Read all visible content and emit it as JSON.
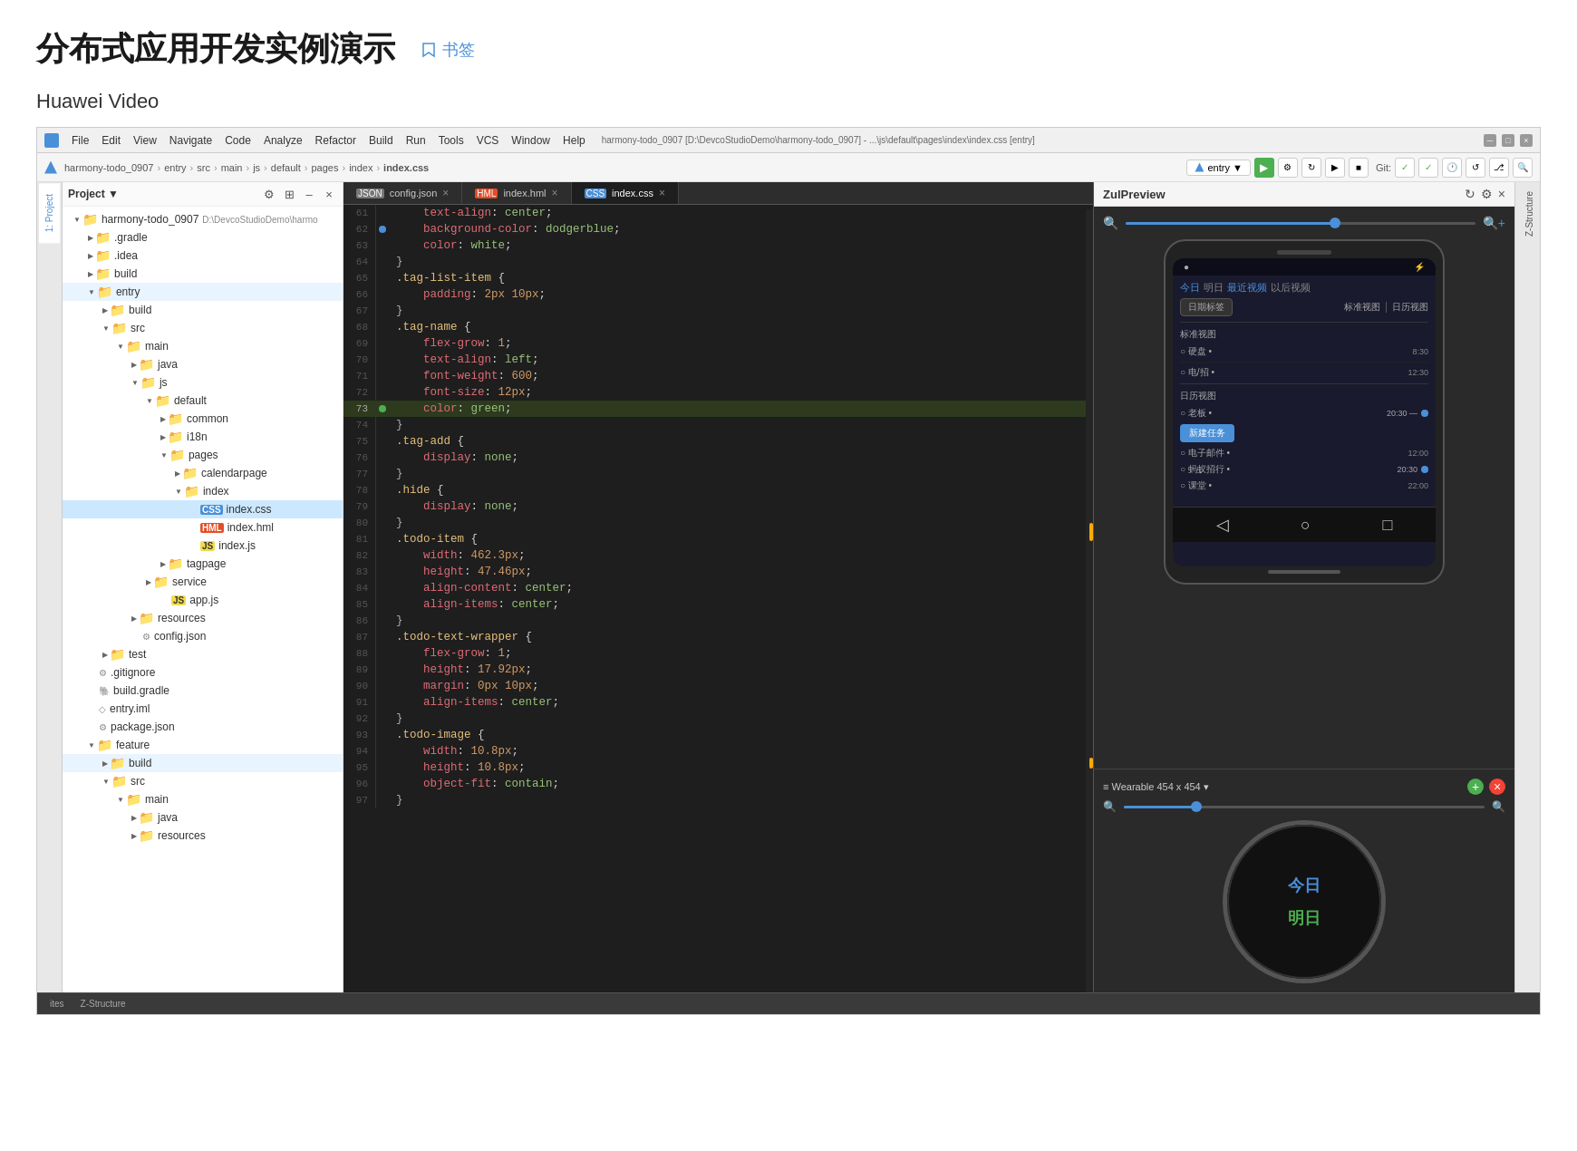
{
  "page": {
    "title": "分布式应用开发实例演示",
    "bookmark_label": "书签",
    "section_title": "Huawei Video"
  },
  "ide": {
    "menubar": {
      "items": [
        "File",
        "Edit",
        "View",
        "Navigate",
        "Code",
        "Analyze",
        "Refactor",
        "Build",
        "Run",
        "Tools",
        "VCS",
        "Window",
        "Help"
      ],
      "window_title": "harmony-todo_0907 [D:\\DevcoStudioDemo\\harmony-todo_0907] - ...\\js\\default\\pages\\index\\index.css [entry]"
    },
    "toolbar": {
      "breadcrumb": [
        "harmony-todo_0907",
        "entry",
        "src",
        "main",
        "js",
        "default",
        "pages",
        "index",
        "index.css"
      ],
      "entry_dropdown": "entry ▼",
      "run_label": "▶"
    },
    "tabs": [
      {
        "name": "config.json",
        "icon": "json",
        "active": false
      },
      {
        "name": "index.hml",
        "icon": "html",
        "active": false
      },
      {
        "name": "index.css",
        "icon": "css",
        "active": true
      }
    ],
    "preview_title": "ZulPreview",
    "side_tabs": [
      "1: Project"
    ],
    "bottom_tabs": [
      "Z-Structure",
      "ites"
    ]
  },
  "file_tree": {
    "root": "Project ▼",
    "items": [
      {
        "id": "harmony-root",
        "label": "harmony-todo_0907",
        "path": "D:\\DevcoStudioDemo\\harmo",
        "type": "folder",
        "depth": 0,
        "open": true
      },
      {
        "id": "gradle",
        "label": ".gradle",
        "type": "folder",
        "depth": 1,
        "open": false
      },
      {
        "id": "idea",
        "label": ".idea",
        "type": "folder",
        "depth": 1,
        "open": false
      },
      {
        "id": "build",
        "label": "build",
        "type": "folder",
        "depth": 1,
        "open": false
      },
      {
        "id": "entry",
        "label": "entry",
        "type": "folder",
        "depth": 1,
        "open": true,
        "selected": false
      },
      {
        "id": "entry-build",
        "label": "build",
        "type": "folder",
        "depth": 2,
        "open": false
      },
      {
        "id": "entry-src",
        "label": "src",
        "type": "folder",
        "depth": 2,
        "open": true
      },
      {
        "id": "main",
        "label": "main",
        "type": "folder",
        "depth": 3,
        "open": true
      },
      {
        "id": "java",
        "label": "java",
        "type": "folder",
        "depth": 4,
        "open": false
      },
      {
        "id": "js",
        "label": "js",
        "type": "folder",
        "depth": 4,
        "open": true
      },
      {
        "id": "default",
        "label": "default",
        "type": "folder",
        "depth": 5,
        "open": true
      },
      {
        "id": "common",
        "label": "common",
        "type": "folder",
        "depth": 6,
        "open": false
      },
      {
        "id": "i18n",
        "label": "i18n",
        "type": "folder",
        "depth": 6,
        "open": false
      },
      {
        "id": "pages",
        "label": "pages",
        "type": "folder",
        "depth": 6,
        "open": true
      },
      {
        "id": "calendarpage",
        "label": "calendarpage",
        "type": "folder",
        "depth": 7,
        "open": false
      },
      {
        "id": "index",
        "label": "index",
        "type": "folder",
        "depth": 7,
        "open": true
      },
      {
        "id": "index-css",
        "label": "index.css",
        "type": "css",
        "depth": 8,
        "selected": true
      },
      {
        "id": "index-hml",
        "label": "index.hml",
        "type": "html",
        "depth": 8
      },
      {
        "id": "index-js",
        "label": "index.js",
        "type": "js",
        "depth": 8
      },
      {
        "id": "tagpage",
        "label": "tagpage",
        "type": "folder",
        "depth": 6,
        "open": false
      },
      {
        "id": "service",
        "label": "service",
        "type": "folder",
        "depth": 5,
        "open": false
      },
      {
        "id": "app-js",
        "label": "app.js",
        "type": "js",
        "depth": 6
      },
      {
        "id": "resources",
        "label": "resources",
        "type": "folder",
        "depth": 4,
        "open": false
      },
      {
        "id": "config-json",
        "label": "config.json",
        "type": "json",
        "depth": 4
      },
      {
        "id": "test",
        "label": "test",
        "type": "folder",
        "depth": 2,
        "open": false
      },
      {
        "id": "gitignore",
        "label": ".gitignore",
        "type": "file",
        "depth": 1
      },
      {
        "id": "build-gradle",
        "label": "build.gradle",
        "type": "gradle",
        "depth": 1
      },
      {
        "id": "entry-iml",
        "label": "entry.iml",
        "type": "iml",
        "depth": 1
      },
      {
        "id": "package-json",
        "label": "package.json",
        "type": "json",
        "depth": 1
      },
      {
        "id": "feature",
        "label": "feature",
        "type": "folder",
        "depth": 1,
        "open": true
      },
      {
        "id": "feature-build",
        "label": "build",
        "type": "folder",
        "depth": 2,
        "open": false
      },
      {
        "id": "feature-src",
        "label": "src",
        "type": "folder",
        "depth": 2,
        "open": true
      },
      {
        "id": "feature-main",
        "label": "main",
        "type": "folder",
        "depth": 3,
        "open": true
      },
      {
        "id": "feature-java",
        "label": "java",
        "type": "folder",
        "depth": 4,
        "open": false
      },
      {
        "id": "feature-resources",
        "label": "resources",
        "type": "folder",
        "depth": 4,
        "open": false
      }
    ]
  },
  "code": {
    "lines": [
      {
        "num": 61,
        "content": "    text-align: center;"
      },
      {
        "num": 62,
        "content": "    background-color: dodgerblue;",
        "marker": "blue"
      },
      {
        "num": 63,
        "content": "    color: white;"
      },
      {
        "num": 64,
        "content": "}"
      },
      {
        "num": 65,
        "content": ".tag-list-item {",
        "selector": true
      },
      {
        "num": 66,
        "content": "    padding: 2px 10px;"
      },
      {
        "num": 67,
        "content": "}"
      },
      {
        "num": 68,
        "content": ".tag-name {",
        "selector": true
      },
      {
        "num": 69,
        "content": "    flex-grow: 1;"
      },
      {
        "num": 70,
        "content": "    text-align: left;"
      },
      {
        "num": 71,
        "content": "    font-weight: 600;",
        "marker": "bar_right"
      },
      {
        "num": 72,
        "content": "    font-size: 12px;",
        "marker": "bar_right"
      },
      {
        "num": 73,
        "content": "    color: green;",
        "marker": "green",
        "highlighted": true
      },
      {
        "num": 74,
        "content": "}"
      },
      {
        "num": 75,
        "content": ".tag-add {",
        "selector": true
      },
      {
        "num": 76,
        "content": "    display: none;"
      },
      {
        "num": 77,
        "content": "}"
      },
      {
        "num": 78,
        "content": ".hide {",
        "selector": true
      },
      {
        "num": 79,
        "content": "    display: none;"
      },
      {
        "num": 80,
        "content": "}"
      },
      {
        "num": 81,
        "content": ".todo-item {",
        "selector": true
      },
      {
        "num": 82,
        "content": "    width: 462.3px;"
      },
      {
        "num": 83,
        "content": "    height: 47.46px;"
      },
      {
        "num": 84,
        "content": "    align-content: center;"
      },
      {
        "num": 85,
        "content": "    align-items: center;"
      },
      {
        "num": 86,
        "content": "}"
      },
      {
        "num": 87,
        "content": ".todo-text-wrapper {",
        "selector": true
      },
      {
        "num": 88,
        "content": "    flex-grow: 1;"
      },
      {
        "num": 89,
        "content": "    height: 17.92px;"
      },
      {
        "num": 90,
        "content": "    margin: 0px 10px;"
      },
      {
        "num": 91,
        "content": "    align-items: center;"
      },
      {
        "num": 92,
        "content": "}"
      },
      {
        "num": 93,
        "content": ".todo-image {",
        "selector": true
      },
      {
        "num": 94,
        "content": "    width: 10.8px;"
      },
      {
        "num": 95,
        "content": "    height: 10.8px;"
      },
      {
        "num": 96,
        "content": "    object-fit: contain;"
      },
      {
        "num": 97,
        "content": "}"
      }
    ]
  },
  "phone_preview": {
    "date_tabs": [
      "今日",
      "明日",
      "最近视频",
      "以后视频"
    ],
    "nav_tabs": [
      "标准视图",
      "日历视图"
    ],
    "todo_items_today": [
      {
        "label": "硬盘 •",
        "time": "8:30",
        "done": false
      },
      {
        "label": "电/招 •",
        "time": "12:30",
        "done": false
      }
    ],
    "todo_items_calendar": [
      {
        "label": "老板 •",
        "time": "20:30 —",
        "done": false
      },
      {
        "label": "电子邮件 •",
        "time": "12:00",
        "done": false
      },
      {
        "label": "蚂蚁招行 •",
        "time": "20:30 •",
        "done": false
      },
      {
        "label": "课堂 •",
        "time": "22:00",
        "done": false
      }
    ],
    "btn_add": "新建任务",
    "btn_cal": "日期标签",
    "nav_icons": [
      "◁",
      "○",
      "□"
    ]
  },
  "watch_preview": {
    "label": "≡ Wearable 454 x 454 ▾",
    "today": "今日",
    "tomorrow": "明日"
  },
  "colors": {
    "accent": "#4a90d9",
    "green": "#4caf50",
    "red": "#f44336",
    "dark_bg": "#1e1e1e",
    "tab_bg": "#2d2d2d"
  }
}
